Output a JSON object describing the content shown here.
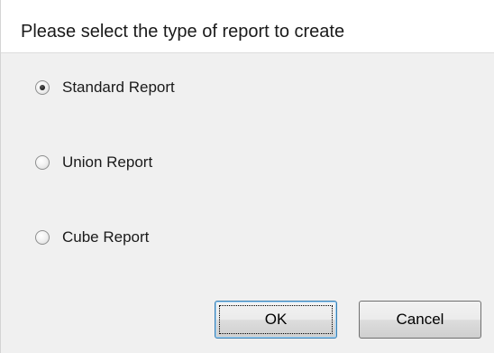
{
  "dialog": {
    "title": "Please select the type of report to create"
  },
  "report_types": {
    "selected": "Standard Report",
    "options": [
      {
        "label": "Standard Report",
        "checked": true
      },
      {
        "label": "Union Report",
        "checked": false
      },
      {
        "label": "Cube Report",
        "checked": false
      }
    ]
  },
  "buttons": {
    "ok_label": "OK",
    "cancel_label": "Cancel"
  }
}
